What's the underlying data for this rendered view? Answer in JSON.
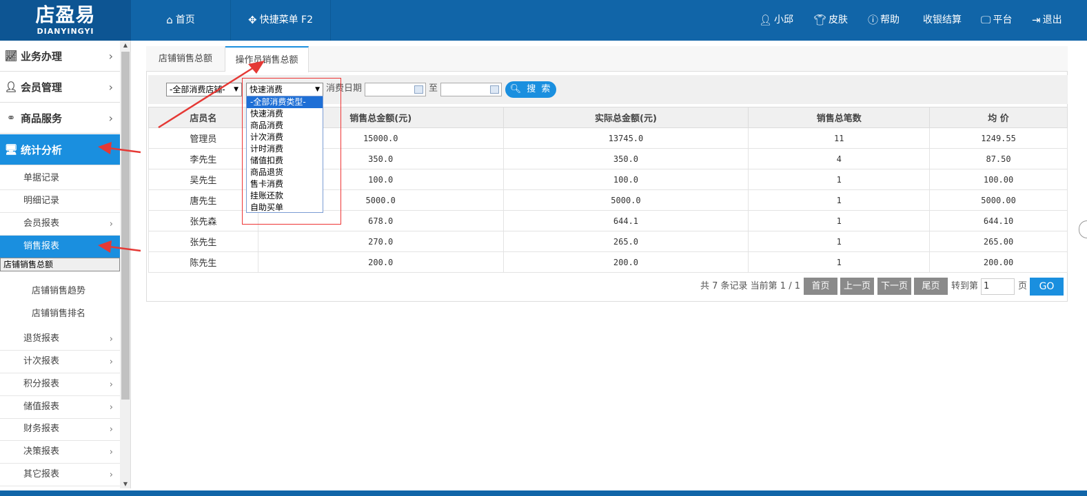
{
  "header": {
    "logo_main": "店盈易",
    "logo_sub": "DIANYINGYI",
    "home": "首页",
    "quick_menu": "快捷菜单 F2",
    "user": "小邱",
    "skin": "皮肤",
    "help": "帮助",
    "checkout": "收银结算",
    "platform": "平台",
    "logout": "退出"
  },
  "sidebar": {
    "menu": [
      {
        "label": "业务办理",
        "icon": "chart-icon"
      },
      {
        "label": "会员管理",
        "icon": "user-icon"
      },
      {
        "label": "商品服务",
        "icon": "link-icon"
      },
      {
        "label": "统计分析",
        "icon": "monitor-icon"
      }
    ],
    "subs_top": [
      "单据记录",
      "明细记录",
      "会员报表",
      "销售报表"
    ],
    "subs_sales": [
      "店铺销售总额",
      "店铺销售趋势",
      "店铺销售排名"
    ],
    "subs_bottom": [
      "退货报表",
      "计次报表",
      "积分报表",
      "储值报表",
      "财务报表",
      "决策报表",
      "其它报表"
    ]
  },
  "tabs": [
    "店铺销售总额",
    "操作员销售总额"
  ],
  "filter": {
    "store_select": "-全部消费店铺-",
    "type_select": "快速消费",
    "date_label": "消费日期",
    "to_label": "至",
    "search_label": "搜 索",
    "type_options": [
      "-全部消费类型-",
      "快速消费",
      "商品消费",
      "计次消费",
      "计时消费",
      "储值扣费",
      "商品退货",
      "售卡消费",
      "挂账还款",
      "自助买单"
    ]
  },
  "table": {
    "columns": [
      "店员名",
      "销售总金额(元)",
      "实际总金额(元)",
      "销售总笔数",
      "均 价"
    ],
    "rows": [
      [
        "管理员",
        "15000.0",
        "13745.0",
        "11",
        "1249.55"
      ],
      [
        "李先生",
        "350.0",
        "350.0",
        "4",
        "87.50"
      ],
      [
        "吴先生",
        "100.0",
        "100.0",
        "1",
        "100.00"
      ],
      [
        "唐先生",
        "5000.0",
        "5000.0",
        "1",
        "5000.00"
      ],
      [
        "张先森",
        "678.0",
        "644.1",
        "1",
        "644.10"
      ],
      [
        "张先生",
        "270.0",
        "265.0",
        "1",
        "265.00"
      ],
      [
        "陈先生",
        "200.0",
        "200.0",
        "1",
        "200.00"
      ]
    ]
  },
  "pager": {
    "info": "共 7 条记录 当前第 1 / 1",
    "first": "首页",
    "prev": "上一页",
    "next": "下一页",
    "last": "尾页",
    "goto_label": "转到第",
    "page_value": "1",
    "page_unit": "页",
    "go": "GO"
  }
}
